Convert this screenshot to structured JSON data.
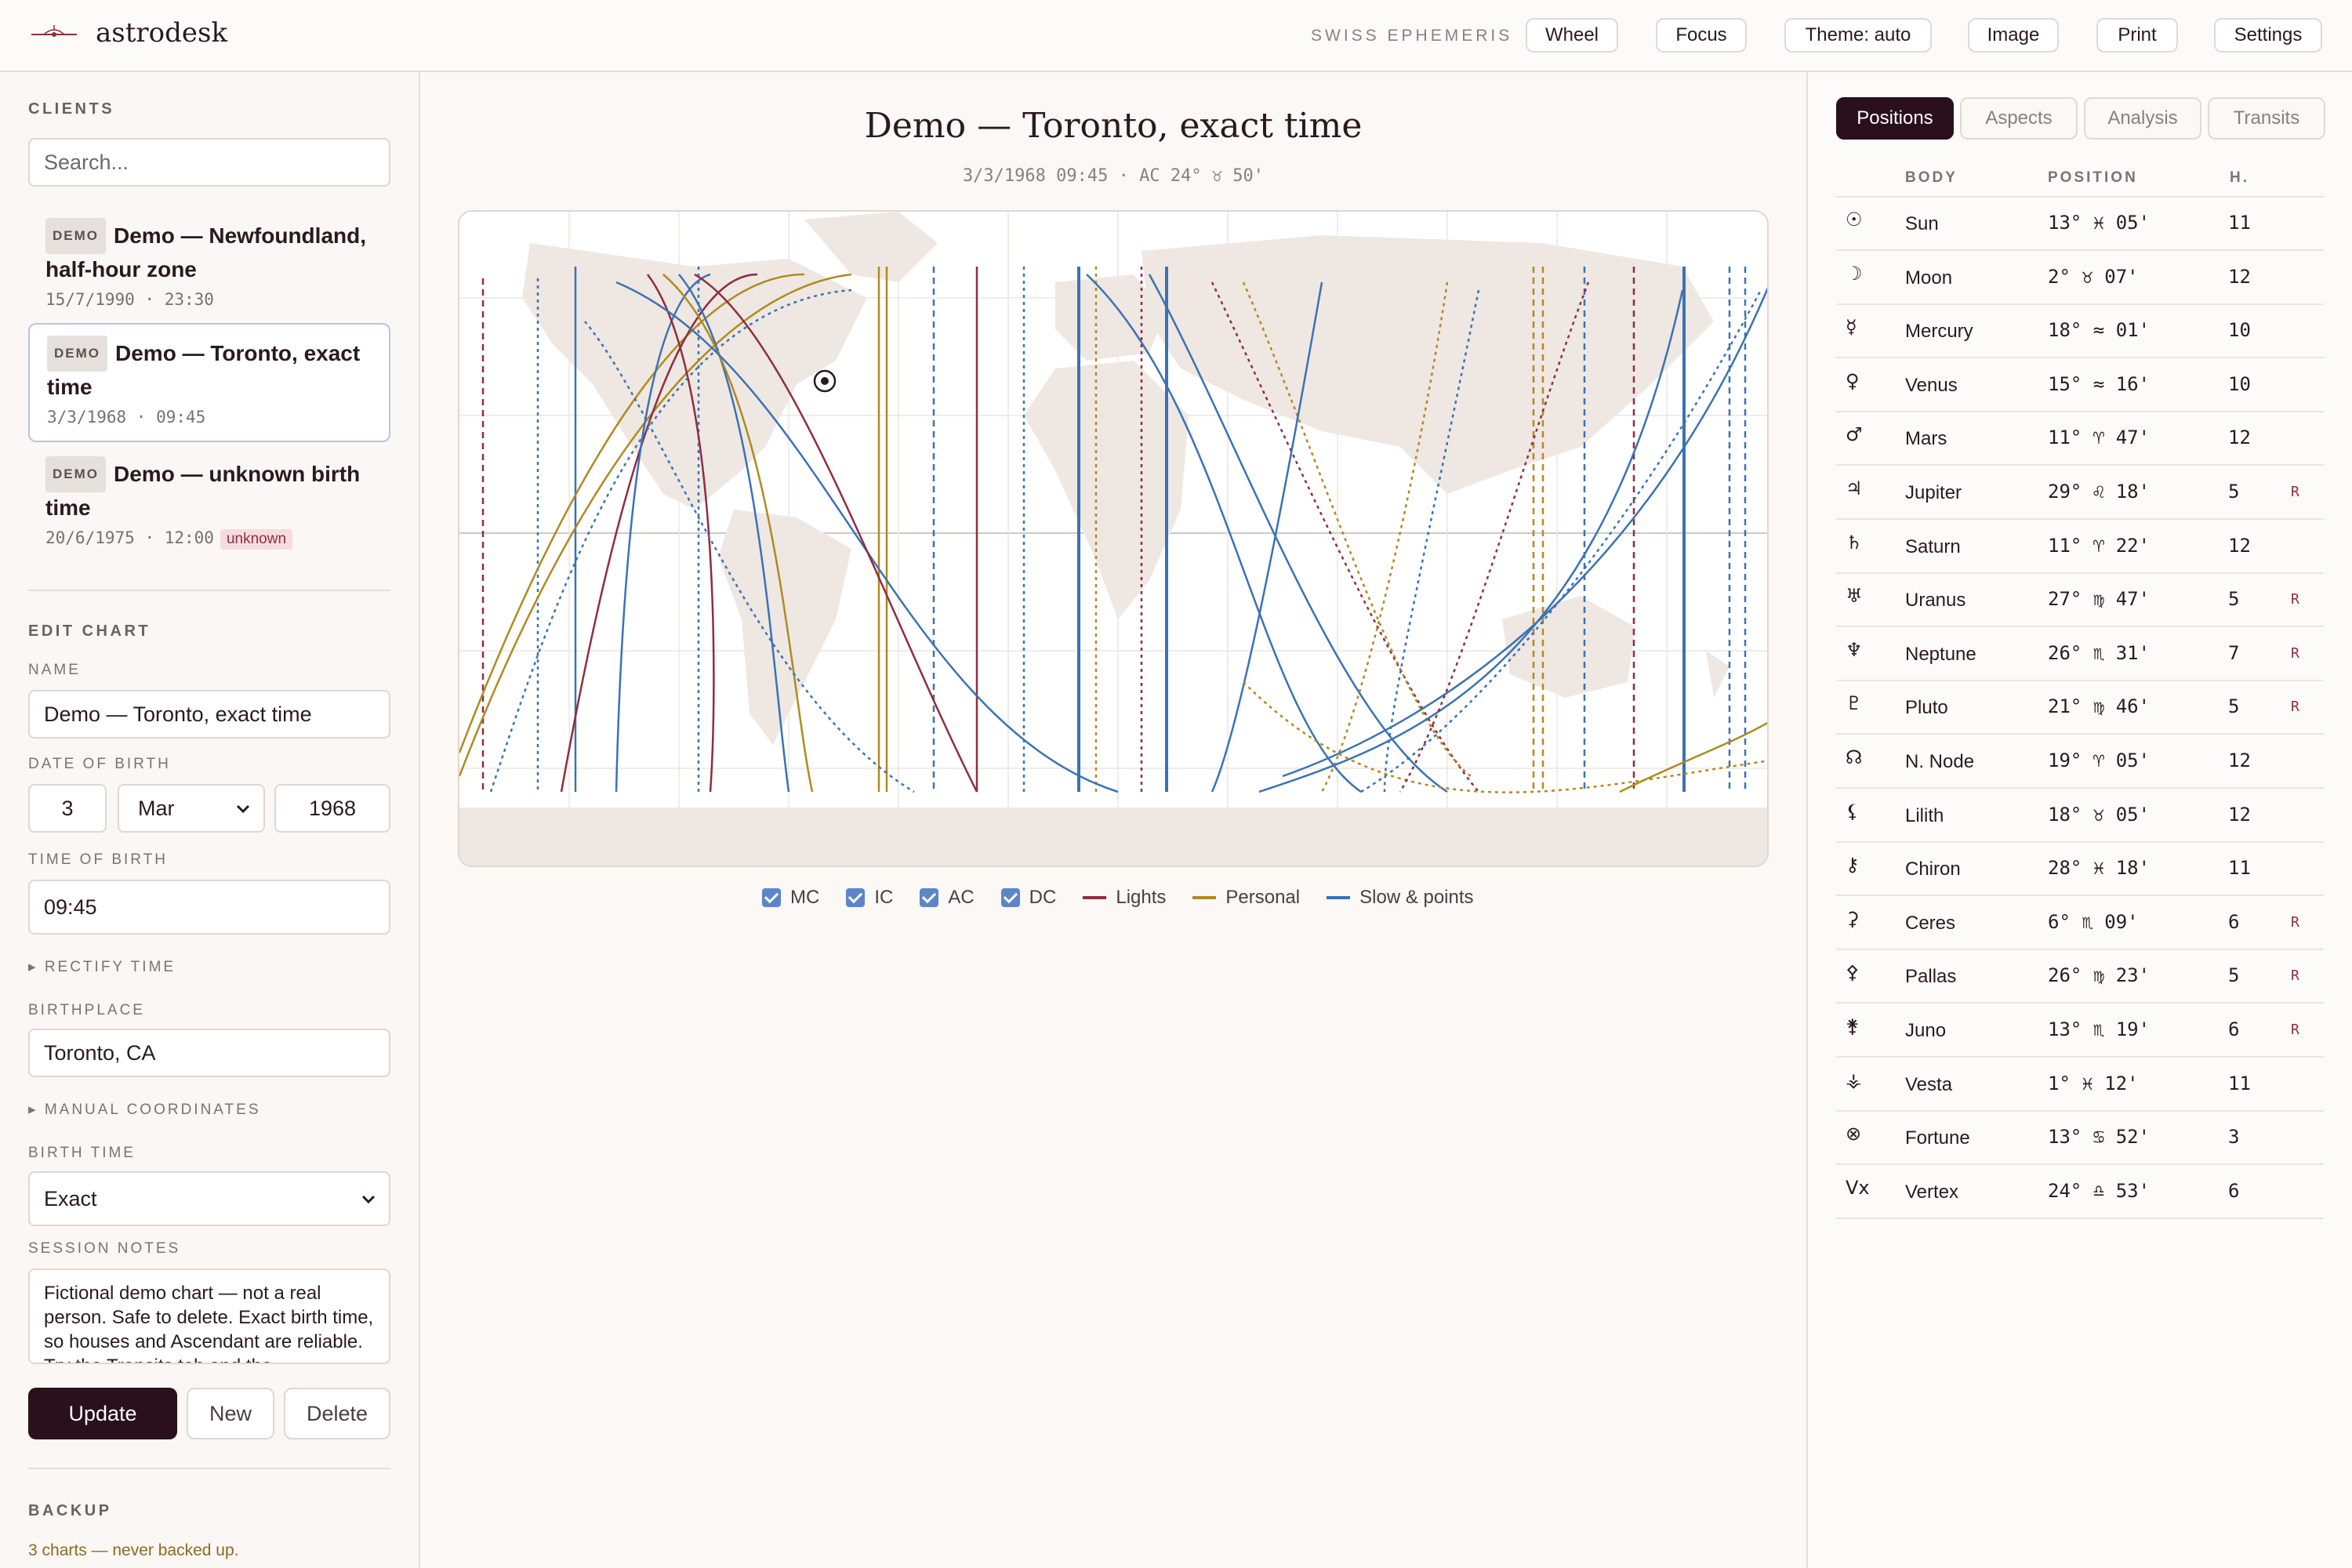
{
  "app": {
    "name": "astrodesk",
    "ephemeris": "SWISS EPHEMERIS"
  },
  "toolbar": {
    "buttons": [
      "Wheel",
      "Focus",
      "Theme: auto",
      "Image",
      "Print",
      "Settings"
    ]
  },
  "clients": {
    "label": "CLIENTS",
    "search_placeholder": "Search...",
    "items": [
      {
        "badge": "DEMO",
        "title": "Demo — Newfoundland, half-hour zone",
        "date": "15/7/1990",
        "time": "23:30",
        "flag": ""
      },
      {
        "badge": "DEMO",
        "title": "Demo — Toronto, exact time",
        "date": "3/3/1968",
        "time": "09:45",
        "flag": ""
      },
      {
        "badge": "DEMO",
        "title": "Demo — unknown birth time",
        "date": "20/6/1975",
        "time": "12:00",
        "flag": "unknown"
      }
    ]
  },
  "edit": {
    "label": "EDIT CHART",
    "name_label": "NAME",
    "name_value": "Demo — Toronto, exact time",
    "dob_label": "DATE OF BIRTH",
    "day": "3",
    "month": "Mar",
    "year": "1968",
    "tob_label": "TIME OF BIRTH",
    "time": "09:45",
    "rectify": "▸ RECTIFY TIME",
    "birthplace_label": "BIRTHPLACE",
    "birthplace": "Toronto, CA",
    "manual": "▸ MANUAL COORDINATES",
    "birthtime_label": "BIRTH TIME",
    "birthtime": "Exact",
    "notes_label": "SESSION NOTES",
    "notes": "Fictional demo chart — not a real person. Safe to delete. Exact birth time, so houses and Ascendant are reliable. Try the Transits tab and the",
    "update": "Update",
    "new": "New",
    "delete": "Delete"
  },
  "backup": {
    "label": "BACKUP",
    "status": "3 charts — never backed up."
  },
  "chart": {
    "title": "Demo — Toronto, exact time",
    "subtitle": "3/3/1968 09:45 · AC 24° ♉ 50'",
    "legend": {
      "checkboxes": [
        "MC",
        "IC",
        "AC",
        "DC"
      ],
      "lines": [
        {
          "label": "Lights",
          "color": "#8e2e40"
        },
        {
          "label": "Personal",
          "color": "#b08a20"
        },
        {
          "label": "Slow & points",
          "color": "#3a72b5"
        }
      ]
    }
  },
  "right": {
    "tabs": [
      "Positions",
      "Aspects",
      "Analysis",
      "Transits"
    ],
    "headers": {
      "body": "BODY",
      "position": "POSITION",
      "house": "H."
    },
    "rows": [
      {
        "glyph": "☉",
        "name": "Sun",
        "pos": "13° ♓ 05'",
        "house": "11",
        "retro": ""
      },
      {
        "glyph": "☽",
        "name": "Moon",
        "pos": "2° ♉ 07'",
        "house": "12",
        "retro": ""
      },
      {
        "glyph": "☿",
        "name": "Mercury",
        "pos": "18° ≈ 01'",
        "house": "10",
        "retro": ""
      },
      {
        "glyph": "♀",
        "name": "Venus",
        "pos": "15° ≈ 16'",
        "house": "10",
        "retro": ""
      },
      {
        "glyph": "♂",
        "name": "Mars",
        "pos": "11° ♈ 47'",
        "house": "12",
        "retro": ""
      },
      {
        "glyph": "♃",
        "name": "Jupiter",
        "pos": "29° ♌ 18'",
        "house": "5",
        "retro": "R"
      },
      {
        "glyph": "♄",
        "name": "Saturn",
        "pos": "11° ♈ 22'",
        "house": "12",
        "retro": ""
      },
      {
        "glyph": "♅",
        "name": "Uranus",
        "pos": "27° ♍ 47'",
        "house": "5",
        "retro": "R"
      },
      {
        "glyph": "♆",
        "name": "Neptune",
        "pos": "26° ♏ 31'",
        "house": "7",
        "retro": "R"
      },
      {
        "glyph": "♇",
        "name": "Pluto",
        "pos": "21° ♍ 46'",
        "house": "5",
        "retro": "R"
      },
      {
        "glyph": "☊",
        "name": "N. Node",
        "pos": "19° ♈ 05'",
        "house": "12",
        "retro": ""
      },
      {
        "glyph": "⚸",
        "name": "Lilith",
        "pos": "18° ♉ 05'",
        "house": "12",
        "retro": ""
      },
      {
        "glyph": "⚷",
        "name": "Chiron",
        "pos": "28° ♓ 18'",
        "house": "11",
        "retro": ""
      },
      {
        "glyph": "⚳",
        "name": "Ceres",
        "pos": "6° ♏ 09'",
        "house": "6",
        "retro": "R"
      },
      {
        "glyph": "⚴",
        "name": "Pallas",
        "pos": "26° ♍ 23'",
        "house": "5",
        "retro": "R"
      },
      {
        "glyph": "⚵",
        "name": "Juno",
        "pos": "13° ♏ 19'",
        "house": "6",
        "retro": "R"
      },
      {
        "glyph": "⚶",
        "name": "Vesta",
        "pos": "1° ♓ 12'",
        "house": "11",
        "retro": ""
      },
      {
        "glyph": "⊗",
        "name": "Fortune",
        "pos": "13° ♋ 52'",
        "house": "3",
        "retro": ""
      },
      {
        "glyph": "Vx",
        "name": "Vertex",
        "pos": "24° ♎ 53'",
        "house": "6",
        "retro": ""
      }
    ]
  },
  "colors": {
    "accent": "#2a0f1c",
    "lights": "#8e2e40",
    "personal": "#b08a20",
    "slow": "#3a72b5",
    "land": "#efe7e2"
  },
  "icons": {
    "logo": "astrodesk-logo-icon",
    "birthplace_marker": "birthplace-marker-icon",
    "select": "chevron-down-icon"
  }
}
